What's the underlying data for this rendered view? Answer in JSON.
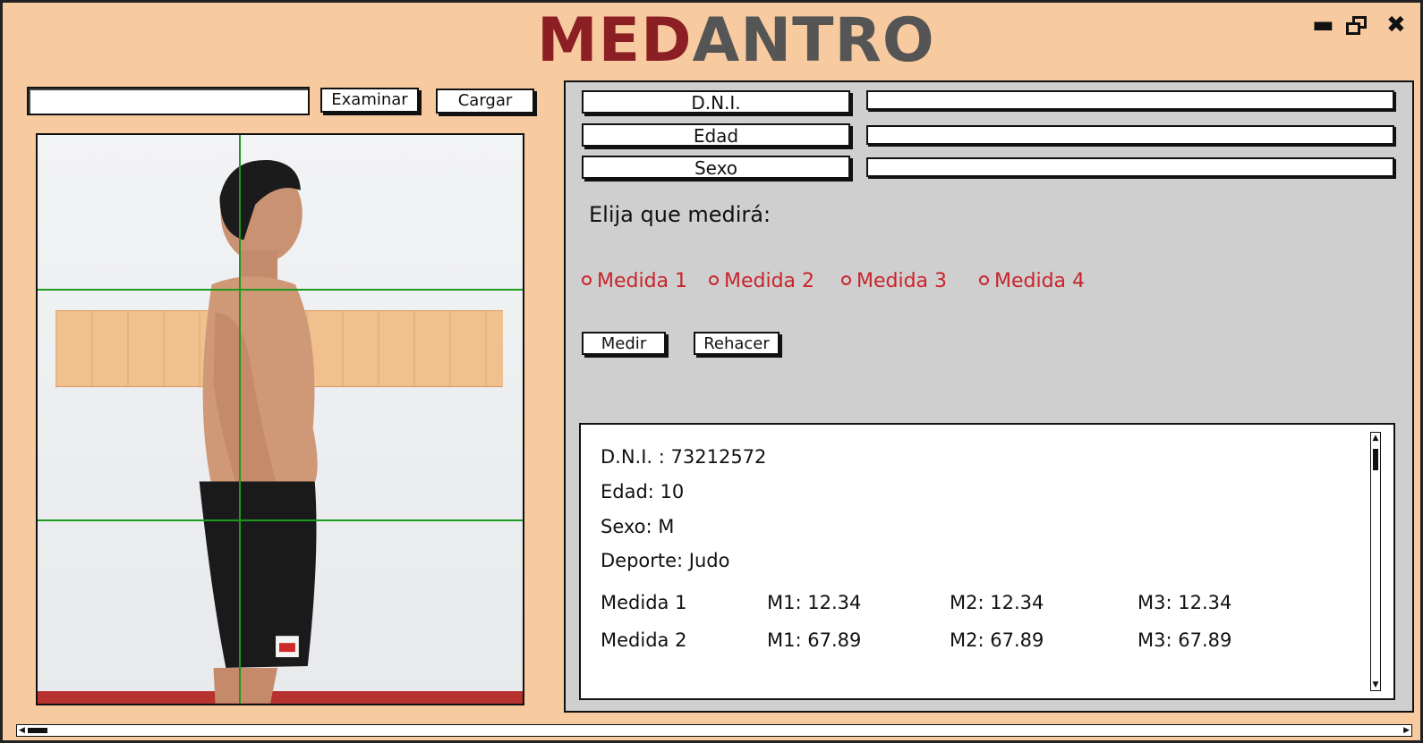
{
  "app": {
    "title_part1": "MED",
    "title_part2": "ANTRO",
    "controls": {
      "minimize": "▬",
      "close": "✖"
    }
  },
  "file": {
    "path_value": "",
    "browse_label": "Examinar",
    "load_label": "Cargar"
  },
  "form": {
    "dni_label": "D.N.I.",
    "age_label": "Edad",
    "sex_label": "Sexo",
    "dni_value": "",
    "age_value": "",
    "sex_value": ""
  },
  "measure": {
    "prompt": "Elija que medirá:",
    "options": [
      "Medida 1",
      "Medida 2",
      "Medida 3",
      "Medida 4"
    ],
    "measure_label": "Medir",
    "redo_label": "Rehacer"
  },
  "results": {
    "dni": "D.N.I. : 73212572",
    "age": "Edad: 10",
    "sex": "Sexo: M",
    "sport": "Deporte: Judo",
    "rows": [
      {
        "name": "Medida 1",
        "m1": "M1: 12.34",
        "m2": "M2: 12.34",
        "m3": "M3: 12.34"
      },
      {
        "name": "Medida 2",
        "m1": "M1: 67.89",
        "m2": "M2: 67.89",
        "m3": "M3: 67.89"
      }
    ]
  },
  "colors": {
    "background": "#f8caa0",
    "panel": "#cfcfcf",
    "accent_red": "#c9242b",
    "logo_red": "#8c1f24",
    "guide_green": "#1c9a1c"
  },
  "icons": {
    "minimize": "minimize-icon",
    "restore": "restore-icon",
    "close": "close-icon",
    "radio": "radio-icon"
  }
}
